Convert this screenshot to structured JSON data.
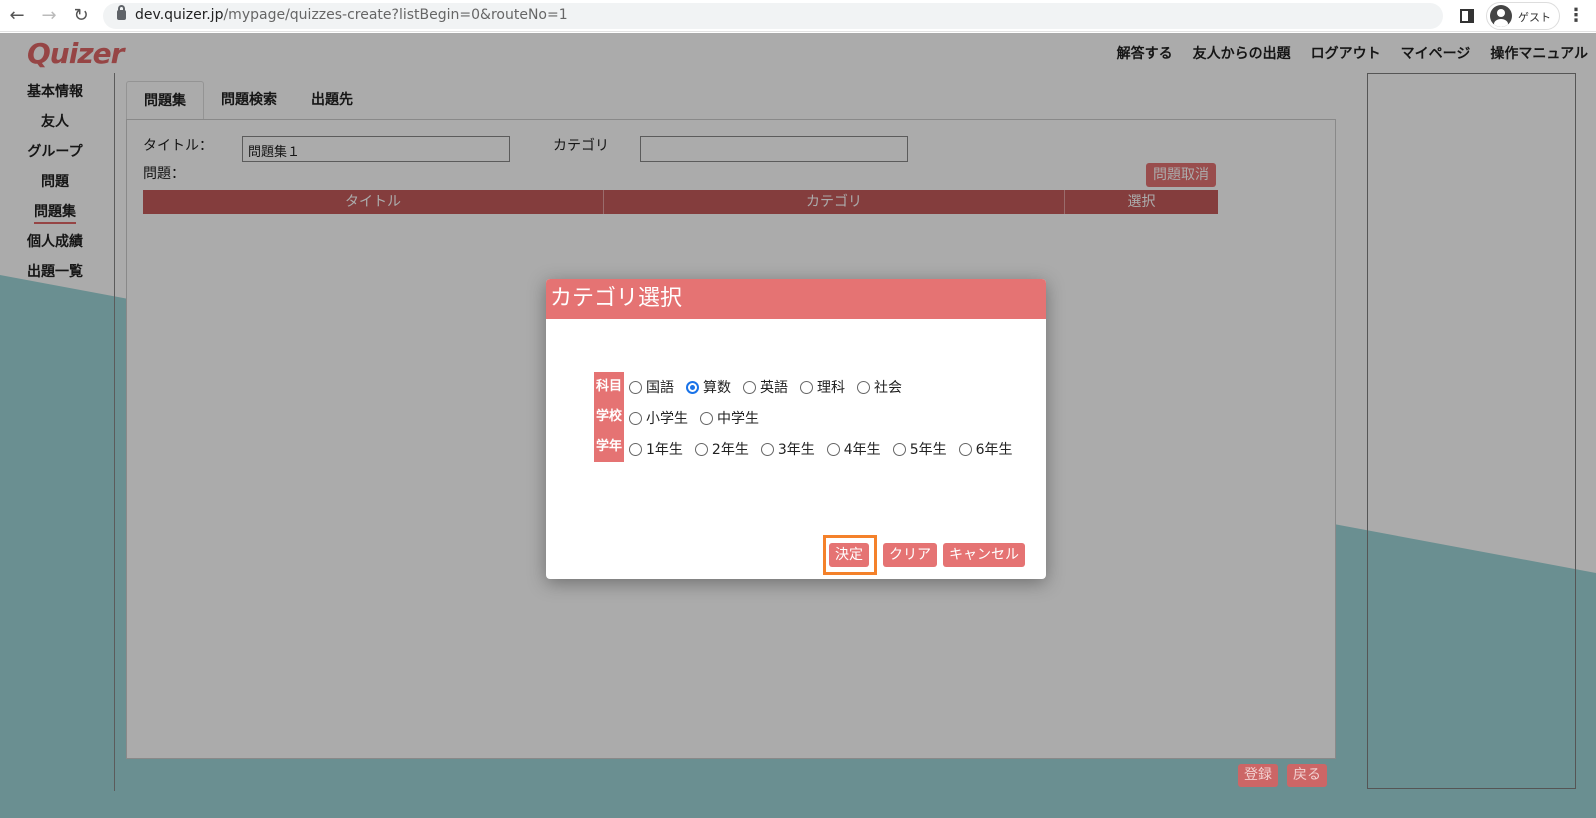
{
  "browser": {
    "url_host": "dev.quizer.jp",
    "url_path": "/mypage/quizzes-create?listBegin=0&routeNo=1",
    "profile_label": "ゲスト",
    "back_icon": "←",
    "forward_icon": "→",
    "reload_icon": "↻",
    "menu_icon": "⋮"
  },
  "app": {
    "logo": "Quizer",
    "top_nav": [
      "解答する",
      "友人からの出題",
      "ログアウト",
      "マイページ",
      "操作マニュアル"
    ],
    "side_nav": [
      "基本情報",
      "友人",
      "グループ",
      "問題",
      "問題集",
      "個人成績",
      "出題一覧"
    ],
    "active_side": "問題集",
    "tabs": [
      "問題集",
      "問題検索",
      "出題先"
    ],
    "active_tab": "問題集",
    "form": {
      "title_label": "タイトル：",
      "title_value": "問題集１",
      "category_label": "カテゴリ",
      "category_value": "",
      "questions_label": "問題："
    },
    "cancel_questions_button": "問題取消",
    "table_headers": [
      "タイトル",
      "カテゴリ",
      "選択"
    ],
    "footer_buttons": [
      "登録",
      "戻る"
    ]
  },
  "modal": {
    "title": "カテゴリ選択",
    "rows": [
      {
        "label": "科目",
        "options": [
          "国語",
          "算数",
          "英語",
          "理科",
          "社会"
        ],
        "selected": "算数"
      },
      {
        "label": "学校",
        "options": [
          "小学生",
          "中学生"
        ],
        "selected": ""
      },
      {
        "label": "学年",
        "options": [
          "1年生",
          "2年生",
          "3年生",
          "4年生",
          "5年生",
          "6年生"
        ],
        "selected": ""
      }
    ],
    "buttons": {
      "confirm": "決定",
      "clear": "クリア",
      "cancel": "キャンセル"
    }
  },
  "colors": {
    "accent": "#e57373",
    "teal_background": "#9ed6d8",
    "focus_ring": "#f4812a"
  }
}
